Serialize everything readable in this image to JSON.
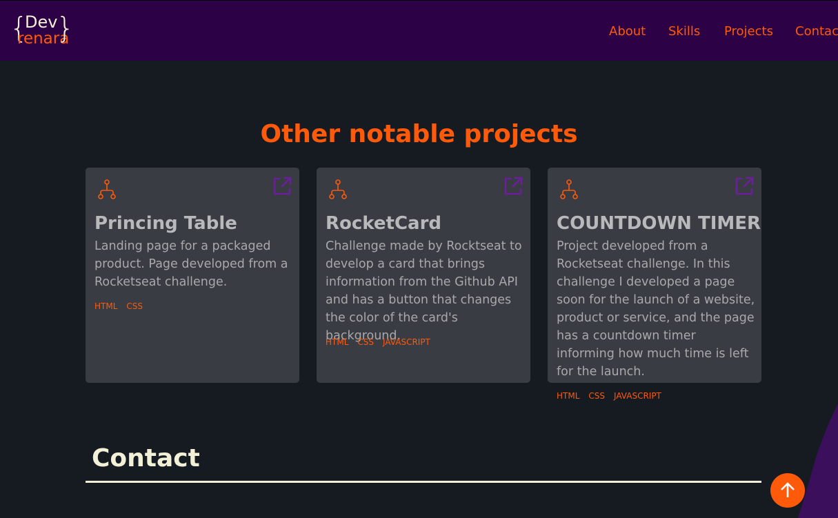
{
  "header": {
    "logo": {
      "line1": "Dev",
      "line2": "renara",
      "brace_left": "{",
      "brace_right": "}"
    },
    "nav": [
      "About",
      "Skills",
      "Projects",
      "Contact"
    ]
  },
  "projects_section": {
    "title": "Other notable projects",
    "cards": [
      {
        "title": "Princing Table",
        "description": "Landing page for a packaged product. Page developed from a Rocketseat challenge.",
        "tags": [
          "HTML",
          "CSS"
        ],
        "icons": [
          "git-fork-icon",
          "external-link-icon"
        ]
      },
      {
        "title": "RocketCard",
        "description": "Challenge made by Rocktseat to develop a card that brings information from the Github API and has a button that changes the color of the card's background.",
        "tags": [
          "HTML",
          "CSS",
          "JAVASCRIPT"
        ],
        "icons": [
          "git-fork-icon",
          "external-link-icon"
        ]
      },
      {
        "title": "COUNTDOWN TIMER",
        "description": "Project developed from a Rocketseat challenge. In this challenge I developed a page soon for the launch of a website, product or service, and the page has a countdown timer informing how much time is left for the launch.",
        "tags": [
          "HTML",
          "CSS",
          "JAVASCRIPT"
        ],
        "icons": [
          "git-fork-icon",
          "external-link-icon"
        ]
      }
    ]
  },
  "contact_section": {
    "title": "Contact"
  },
  "scroll_top": {
    "icon": "arrow-up-icon"
  },
  "colors": {
    "background": "#161b22",
    "header": "#2d0145",
    "accent": "#ff5a0a",
    "card": "#393c43",
    "icon_purple": "#6b1f9a",
    "cream": "#f2f0d6"
  }
}
